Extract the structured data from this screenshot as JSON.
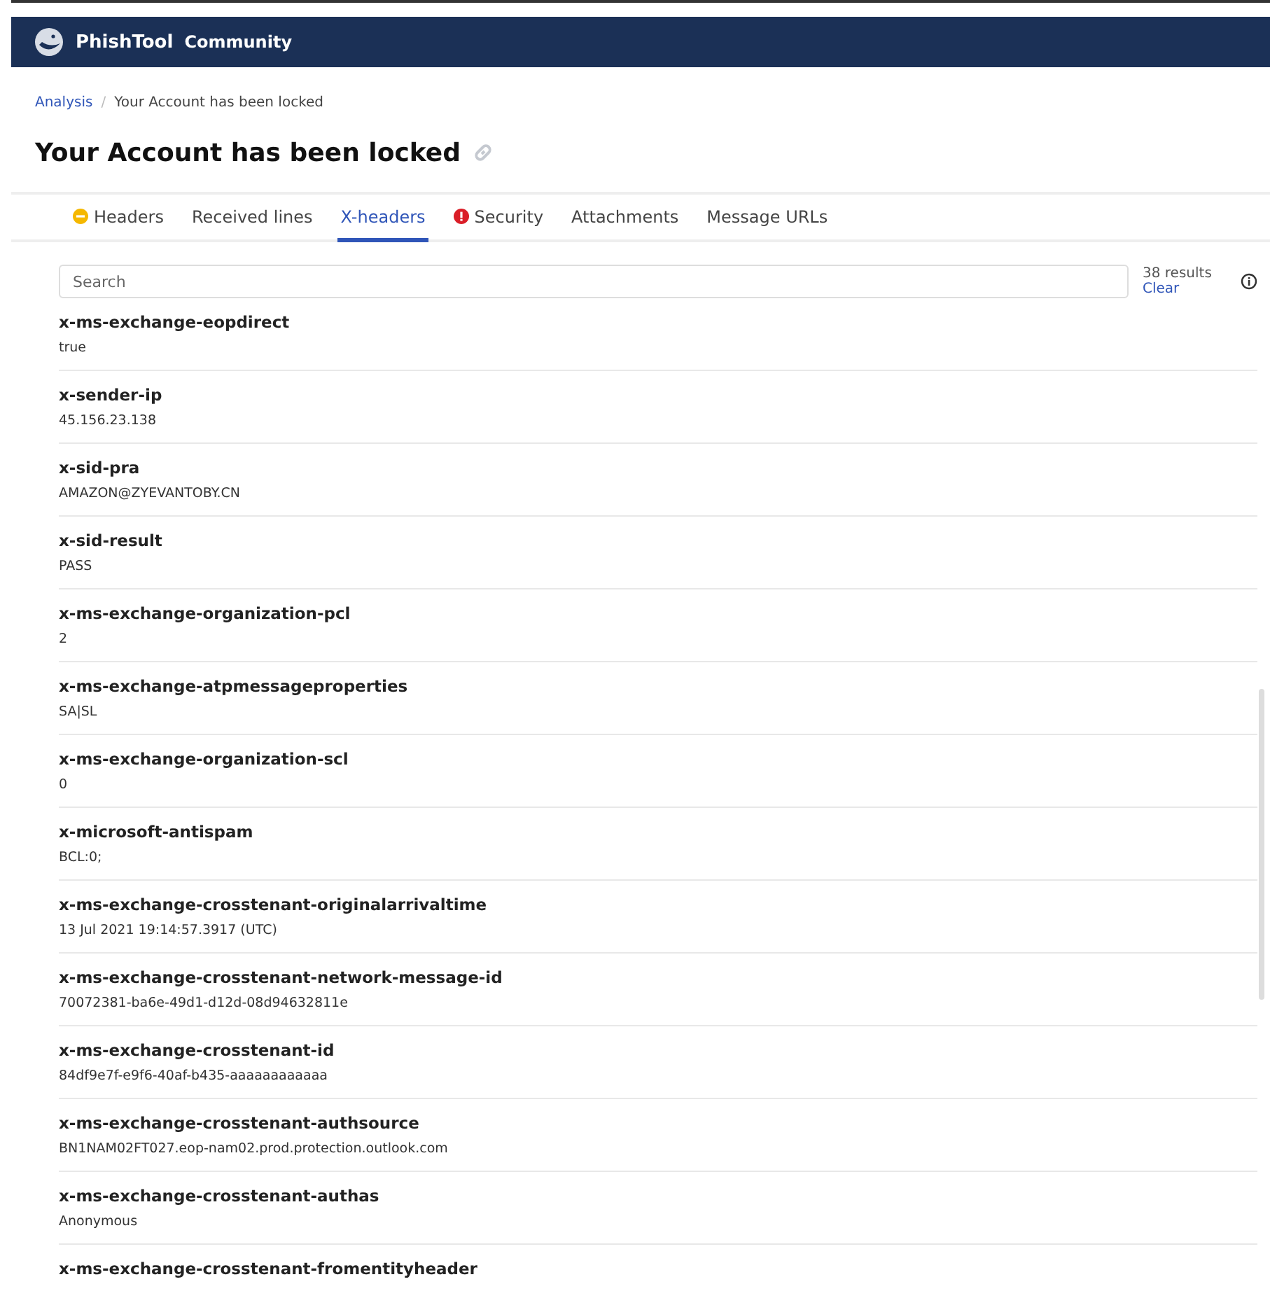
{
  "navbar": {
    "brand": "PhishTool",
    "edition": "Community"
  },
  "breadcrumb_separator": "/",
  "breadcrumb": [
    {
      "label": "Analysis",
      "link": true
    },
    {
      "label": "Your Account has been locked",
      "link": false
    }
  ],
  "title": "Your Account has been locked",
  "tabs": [
    {
      "label": "Headers",
      "selected": false,
      "warning": true,
      "error": false
    },
    {
      "label": "Received lines",
      "selected": false,
      "warning": false,
      "error": false
    },
    {
      "label": "X-headers",
      "selected": true,
      "warning": false,
      "error": false
    },
    {
      "label": "Security",
      "selected": false,
      "warning": false,
      "error": true
    },
    {
      "label": "Attachments",
      "selected": false,
      "warning": false,
      "error": false
    },
    {
      "label": "Message URLs",
      "selected": false,
      "warning": false,
      "error": false
    }
  ],
  "search": {
    "placeholder": "Search",
    "results": "38 results",
    "clear": "Clear"
  },
  "headers": [
    {
      "name": "x-ms-exchange-eopdirect",
      "value": "true"
    },
    {
      "name": "x-sender-ip",
      "value": "45.156.23.138"
    },
    {
      "name": "x-sid-pra",
      "value": "AMAZON@ZYEVANTOBY.CN"
    },
    {
      "name": "x-sid-result",
      "value": "PASS"
    },
    {
      "name": "x-ms-exchange-organization-pcl",
      "value": "2"
    },
    {
      "name": "x-ms-exchange-atpmessageproperties",
      "value": "SA|SL"
    },
    {
      "name": "x-ms-exchange-organization-scl",
      "value": "0"
    },
    {
      "name": "x-microsoft-antispam",
      "value": "BCL:0;"
    },
    {
      "name": "x-ms-exchange-crosstenant-originalarrivaltime",
      "value": "13 Jul 2021 19:14:57.3917 (UTC)"
    },
    {
      "name": "x-ms-exchange-crosstenant-network-message-id",
      "value": "70072381-ba6e-49d1-d12d-08d94632811e"
    },
    {
      "name": "x-ms-exchange-crosstenant-id",
      "value": "84df9e7f-e9f6-40af-b435-aaaaaaaaaaaa"
    },
    {
      "name": "x-ms-exchange-crosstenant-authsource",
      "value": "BN1NAM02FT027.eop-nam02.prod.protection.outlook.com"
    },
    {
      "name": "x-ms-exchange-crosstenant-authas",
      "value": "Anonymous"
    },
    {
      "name": "x-ms-exchange-crosstenant-fromentityheader"
    }
  ]
}
